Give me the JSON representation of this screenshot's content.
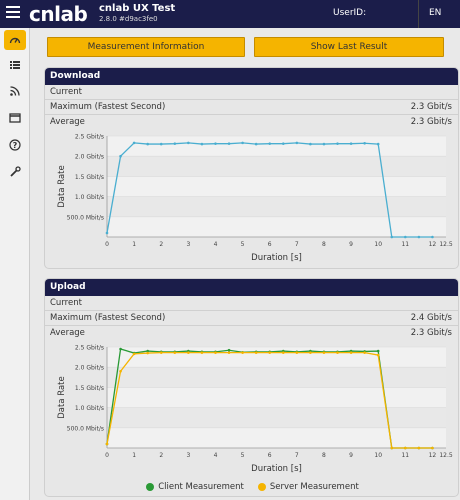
{
  "header": {
    "logo_text": "cnlab",
    "title": "cnlab UX Test",
    "version": "2.8.0 #d9ac3fe0",
    "userid_label": "UserID:",
    "userid_value": "",
    "language": "EN"
  },
  "sidebar": {
    "items": [
      {
        "icon": "speedometer-icon",
        "active": true
      },
      {
        "icon": "list-icon",
        "active": false
      },
      {
        "icon": "rss-icon",
        "active": false
      },
      {
        "icon": "window-icon",
        "active": false
      },
      {
        "icon": "help-icon",
        "active": false
      },
      {
        "icon": "wrench-icon",
        "active": false
      }
    ]
  },
  "buttons": {
    "measurement_info": "Measurement Information",
    "show_last_result": "Show Last Result"
  },
  "download": {
    "title": "Download",
    "current_label": "Current",
    "current_value": "",
    "max_label": "Maximum (Fastest Second)",
    "max_value": "2.3 Gbit/s",
    "avg_label": "Average",
    "avg_value": "2.3 Gbit/s"
  },
  "upload": {
    "title": "Upload",
    "current_label": "Current",
    "current_value": "",
    "max_label": "Maximum (Fastest Second)",
    "max_value": "2.4 Gbit/s",
    "avg_label": "Average",
    "avg_value": "2.3 Gbit/s",
    "legend_client": "Client Measurement",
    "legend_server": "Server Measurement"
  },
  "colors": {
    "navy": "#1b1d4a",
    "accent": "#f5b400",
    "download_line": "#4aaed0",
    "client_line": "#2a9a36",
    "server_line": "#f5b400"
  },
  "chart_data": [
    {
      "type": "line",
      "title": "Download",
      "xlabel": "Duration [s]",
      "ylabel": "Data Rate",
      "xlim": [
        0,
        12.5
      ],
      "ylim": [
        0,
        2.5
      ],
      "x_ticks": [
        "0",
        "1",
        "2",
        "3",
        "4",
        "5",
        "6",
        "7",
        "8",
        "9",
        "10",
        "11",
        "12",
        "12.5"
      ],
      "x_tick_values": [
        0,
        1,
        2,
        3,
        4,
        5,
        6,
        7,
        8,
        9,
        10,
        11,
        12,
        12.5
      ],
      "y_ticks": [
        "500.0 Mbit/s",
        "1.0 Gbit/s",
        "1.5 Gbit/s",
        "2.0 Gbit/s",
        "2.5 Gbit/s"
      ],
      "y_tick_values": [
        0.5,
        1.0,
        1.5,
        2.0,
        2.5
      ],
      "series": [
        {
          "name": "",
          "color": "#4aaed0",
          "x": [
            0,
            0.5,
            1,
            1.5,
            2,
            2.5,
            3,
            3.5,
            4,
            4.5,
            5,
            5.5,
            6,
            6.5,
            7,
            7.5,
            8,
            8.5,
            9,
            9.5,
            10,
            10.5,
            11,
            11.5,
            12
          ],
          "y": [
            0.1,
            2.0,
            2.33,
            2.3,
            2.3,
            2.31,
            2.33,
            2.3,
            2.31,
            2.31,
            2.33,
            2.3,
            2.31,
            2.31,
            2.33,
            2.3,
            2.3,
            2.31,
            2.31,
            2.32,
            2.3,
            0.0,
            0.0,
            0.0,
            0.0
          ]
        }
      ]
    },
    {
      "type": "line",
      "title": "Upload",
      "xlabel": "Duration [s]",
      "ylabel": "Data Rate",
      "xlim": [
        0,
        12.5
      ],
      "ylim": [
        0,
        2.5
      ],
      "x_ticks": [
        "0",
        "1",
        "2",
        "3",
        "4",
        "5",
        "6",
        "7",
        "8",
        "9",
        "10",
        "11",
        "12",
        "12.5"
      ],
      "x_tick_values": [
        0,
        1,
        2,
        3,
        4,
        5,
        6,
        7,
        8,
        9,
        10,
        11,
        12,
        12.5
      ],
      "y_ticks": [
        "500.0 Mbit/s",
        "1.0 Gbit/s",
        "1.5 Gbit/s",
        "2.0 Gbit/s",
        "2.5 Gbit/s"
      ],
      "y_tick_values": [
        0.5,
        1.0,
        1.5,
        2.0,
        2.5
      ],
      "series": [
        {
          "name": "Client Measurement",
          "color": "#2a9a36",
          "x": [
            0,
            0.5,
            1,
            1.5,
            2,
            2.5,
            3,
            3.5,
            4,
            4.5,
            5,
            5.5,
            6,
            6.5,
            7,
            7.5,
            8,
            8.5,
            9,
            9.5,
            10,
            10.5,
            11,
            11.5,
            12
          ],
          "y": [
            0.1,
            2.45,
            2.35,
            2.4,
            2.38,
            2.38,
            2.4,
            2.38,
            2.38,
            2.42,
            2.37,
            2.38,
            2.38,
            2.4,
            2.38,
            2.4,
            2.38,
            2.38,
            2.4,
            2.39,
            2.4,
            0.0,
            0.0,
            0.0,
            0.0
          ]
        },
        {
          "name": "Server Measurement",
          "color": "#f5b400",
          "x": [
            0,
            0.5,
            1,
            1.5,
            2,
            2.5,
            3,
            3.5,
            4,
            4.5,
            5,
            5.5,
            6,
            6.5,
            7,
            7.5,
            8,
            8.5,
            9,
            9.5,
            10,
            10.5,
            11,
            11.5,
            12
          ],
          "y": [
            0.1,
            1.9,
            2.33,
            2.35,
            2.36,
            2.36,
            2.36,
            2.36,
            2.36,
            2.36,
            2.36,
            2.36,
            2.36,
            2.36,
            2.36,
            2.36,
            2.36,
            2.36,
            2.36,
            2.36,
            2.3,
            0.0,
            0.0,
            0.0,
            0.0
          ]
        }
      ]
    }
  ]
}
